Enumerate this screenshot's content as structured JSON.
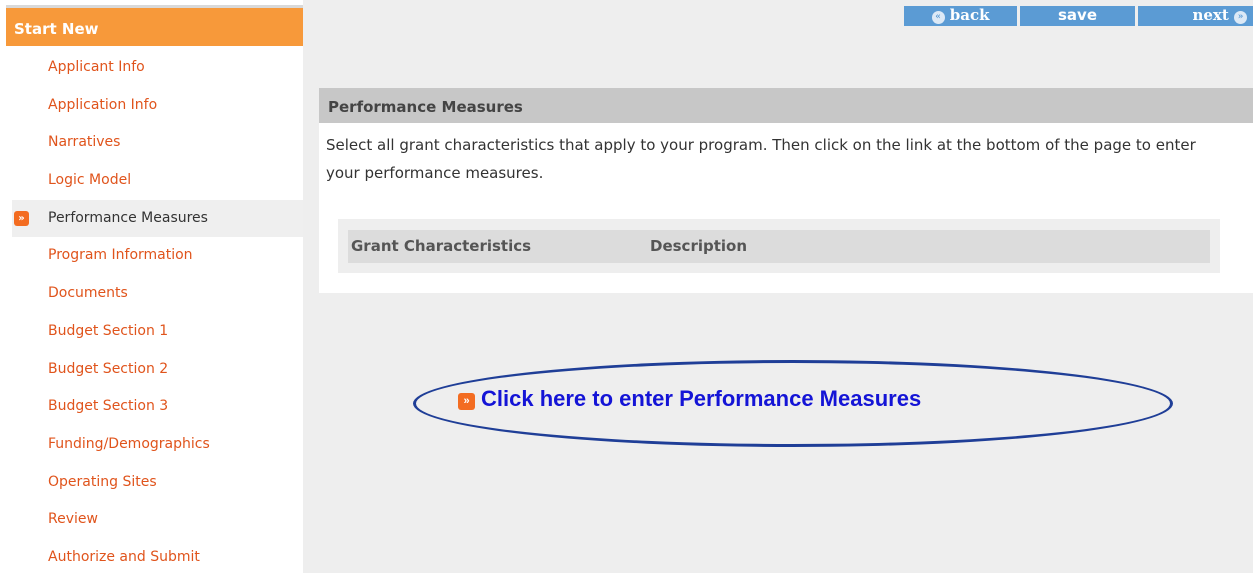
{
  "sidebar": {
    "header": "Start New",
    "items": [
      {
        "label": "Applicant Info"
      },
      {
        "label": "Application Info"
      },
      {
        "label": "Narratives"
      },
      {
        "label": "Logic Model"
      },
      {
        "label": "Performance Measures",
        "active": true
      },
      {
        "label": "Program Information"
      },
      {
        "label": "Documents"
      },
      {
        "label": "Budget Section 1"
      },
      {
        "label": "Budget Section 2"
      },
      {
        "label": "Budget Section 3"
      },
      {
        "label": "Funding/Demographics"
      },
      {
        "label": "Operating Sites"
      },
      {
        "label": "Review"
      },
      {
        "label": "Authorize and Submit"
      }
    ]
  },
  "toolbar": {
    "back_label": "back",
    "save_label": "save",
    "next_label": "next"
  },
  "panel": {
    "title": "Performance Measures",
    "instructions": "Select all grant characteristics that apply to your program. Then click on the link at the bottom of the page to enter your performance measures.",
    "columns": [
      "Grant Characteristics",
      "Description"
    ]
  },
  "cta": {
    "label": "Click here to enter Performance Measures"
  },
  "colors": {
    "accent_orange": "#f7993a",
    "nav_link": "#e0541c",
    "button_blue": "#5b9bd4",
    "cta_blue": "#1414d6",
    "ellipse": "#1f3e97"
  },
  "icons": {
    "nav_active": "arrow-right-icon",
    "back": "arrow-left-circle-icon",
    "next": "arrow-right-circle-icon",
    "cta": "arrow-right-icon"
  }
}
